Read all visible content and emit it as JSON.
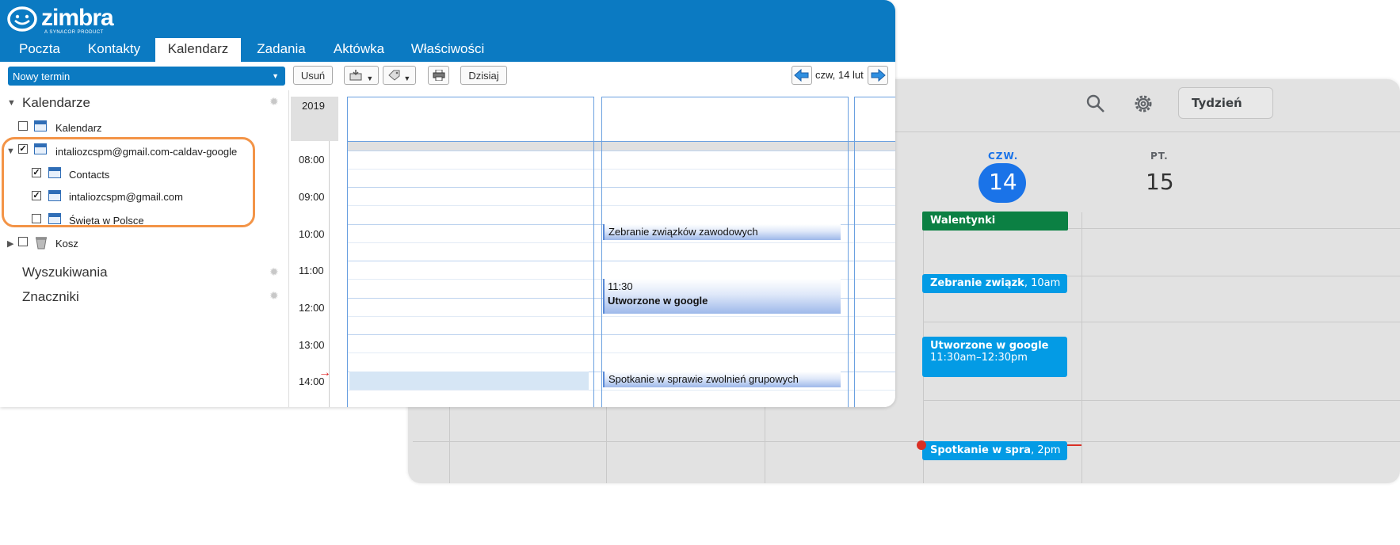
{
  "gcal": {
    "toolbar": {
      "search_icon": "search-icon",
      "settings_icon": "gear-icon",
      "view_button": "Tydzień"
    },
    "days": [
      {
        "name": "CZW.",
        "number": "14",
        "today": true
      },
      {
        "name": "PT.",
        "number": "15",
        "today": false
      }
    ],
    "events": [
      {
        "title": "Walentynki",
        "time": "",
        "color": "#0b8043"
      },
      {
        "title": "Zebranie związk",
        "time": ", 10am",
        "color": "#039be5"
      },
      {
        "title": "Utworzone w google",
        "time": "11:30am–12:30pm",
        "color": "#039be5"
      },
      {
        "title": "Spotkanie w spra",
        "time": ", 2pm",
        "color": "#039be5"
      }
    ],
    "colors": {
      "accent": "#1a73e8",
      "now_line": "#d93025"
    }
  },
  "zimbra": {
    "logo": {
      "name": "zimbra",
      "tagline": "A SYNACOR PRODUCT"
    },
    "tabs": [
      "Poczta",
      "Kontakty",
      "Kalendarz",
      "Zadania",
      "Aktówka",
      "Właściwości"
    ],
    "active_tab": "Kalendarz",
    "toolbar": {
      "new_appointment": "Nowy termin",
      "delete": "Usuń",
      "today": "Dzisiaj",
      "date": "czw, 14 lut"
    },
    "sidebar": {
      "calendars_header": "Kalendarze",
      "items": [
        {
          "label": "Kalendarz",
          "checked": false
        },
        {
          "label": "intaliozcspm@gmail.com-caldav-google",
          "checked": true
        },
        {
          "label": "Contacts",
          "checked": true
        },
        {
          "label": "intaliozcspm@gmail.com",
          "checked": true
        },
        {
          "label": "Święta w Polsce",
          "checked": false
        },
        {
          "label": "Kosz",
          "checked": false
        }
      ],
      "searches": "Wyszukiwania",
      "tags": "Znaczniki"
    },
    "grid": {
      "year": "2019",
      "hours": [
        "08:00",
        "09:00",
        "10:00",
        "11:00",
        "12:00",
        "13:00",
        "14:00"
      ],
      "events": [
        {
          "title": "Zebranie związków zawodowych",
          "time": ""
        },
        {
          "title": "Utworzone w google",
          "time": "11:30"
        },
        {
          "title": "Spotkanie w sprawie zwolnień grupowych",
          "time": ""
        }
      ]
    },
    "colors": {
      "header": "#0b7ac2",
      "highlight": "#f39447"
    }
  }
}
